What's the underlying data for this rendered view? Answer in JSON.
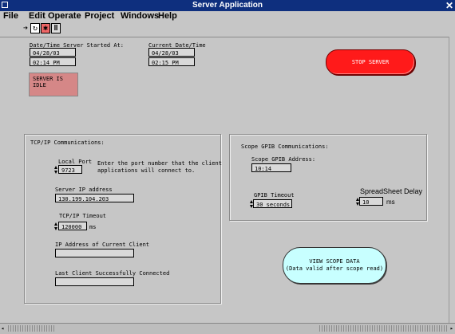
{
  "window": {
    "title": "Server Application"
  },
  "menu": [
    "File",
    "Edit",
    "Operate",
    "Project",
    "Windows",
    "Help"
  ],
  "server_start": {
    "label": "Date/Time Server Started At:",
    "date": "04/28/03",
    "time": "02:14 PM"
  },
  "current": {
    "label": "Current Date/Time",
    "date": "04/28/03",
    "time": "02:15 PM"
  },
  "status": {
    "text": "SERVER IS IDLE"
  },
  "stop_button": {
    "label": "STOP SERVER"
  },
  "tcp": {
    "title": "TCP/IP Communications:",
    "local_port_label": "Local Port",
    "local_port_value": "9723",
    "port_help": "Enter the port number that the client\napplications will connect to.",
    "server_ip_label": "Server IP address",
    "server_ip_value": "130.199.104.203",
    "timeout_label": "TCP/IP Timeout",
    "timeout_value": "120000",
    "timeout_unit": "ms",
    "client_ip_label": "IP Address of Current Client",
    "client_ip_value": "",
    "last_client_label": "Last Client Successfully Connected",
    "last_client_value": ""
  },
  "gpib": {
    "title": "Scope GPIB Communications:",
    "address_label": "Scope GPIB Address:",
    "address_value": "10:14",
    "timeout_label": "GPIB Timeout",
    "timeout_value": "30 seconds",
    "spread_label": "SpreadSheet Delay",
    "spread_value": "10",
    "spread_unit": "ms"
  },
  "view_button": {
    "line1": "VIEW SCOPE DATA",
    "line2": "(Data valid after scope read)"
  },
  "colors": {
    "title_bar": "#0e2f7e",
    "stop_button": "#ff1a1a",
    "status_box": "#d58787",
    "view_button": "#c8ffff"
  }
}
